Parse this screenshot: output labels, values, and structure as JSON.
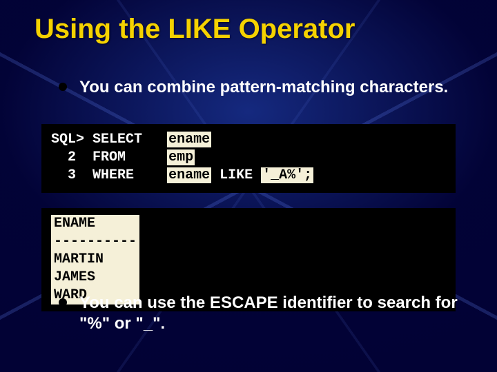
{
  "title": "Using the LIKE Operator",
  "bullets": {
    "b1": "You can combine pattern-matching characters.",
    "b2": "You can use the ESCAPE identifier to search for \"%\" or \"_\"."
  },
  "sql": {
    "prompt": "SQL>",
    "line1_kw": "SELECT",
    "line1_col": "ename",
    "line2_num": "  2 ",
    "line2_kw": "FROM",
    "line2_tab": "emp",
    "line3_num": "  3 ",
    "line3_kw": "WHERE",
    "line3_cond_pre": "ename",
    "line3_like": " LIKE ",
    "line3_pattern": "'_A%';"
  },
  "result": {
    "header": "ENAME",
    "sep": "----------",
    "rows": [
      "MARTIN",
      "JAMES",
      "WARD"
    ]
  }
}
